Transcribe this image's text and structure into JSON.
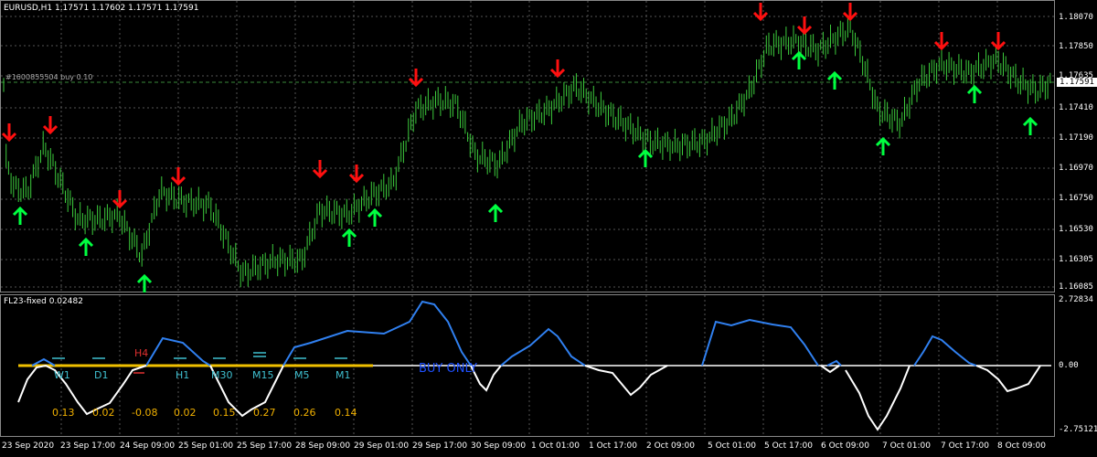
{
  "header": {
    "title": "EURUSD,H1  1.17571 1.17602 1.17571 1.17591",
    "order_line": "#1600855504 buy 0.10",
    "current_price": "1.17591"
  },
  "price_scale": [
    "1.18070",
    "1.17850",
    "1.17635",
    "1.17410",
    "1.17190",
    "1.16970",
    "1.16750",
    "1.16530",
    "1.16305",
    "1.16085"
  ],
  "indicator": {
    "title": "FL23-fixed 0.02482",
    "scale": [
      "2.72834",
      "0.00",
      "-2.75121"
    ],
    "timeframes": [
      "W1",
      "D1",
      "H4",
      "H1",
      "M30",
      "M15",
      "M5",
      "M1"
    ],
    "values": [
      "0.13",
      "0.02",
      "-0.08",
      "0.02",
      "0.15",
      "0.27",
      "0.26",
      "0.14"
    ],
    "status": "BUY ONLY"
  },
  "time_axis": [
    "23 Sep 2020",
    "23 Sep 17:00",
    "24 Sep 09:00",
    "25 Sep 01:00",
    "25 Sep 17:00",
    "28 Sep 09:00",
    "29 Sep 01:00",
    "29 Sep 17:00",
    "30 Sep 09:00",
    "1 Oct 01:00",
    "1 Oct 17:00",
    "2 Oct 09:00",
    "5 Oct 01:00",
    "5 Oct 17:00",
    "6 Oct 09:00",
    "7 Oct 01:00",
    "7 Oct 17:00",
    "8 Oct 09:00"
  ],
  "colors": {
    "bull": "#3ccc3c",
    "up_arrow": "#00ff40",
    "down_arrow": "#ff1010",
    "ind_blue": "#3080f0",
    "ind_white": "#ffffff",
    "zero_line": "#f0c000"
  }
}
